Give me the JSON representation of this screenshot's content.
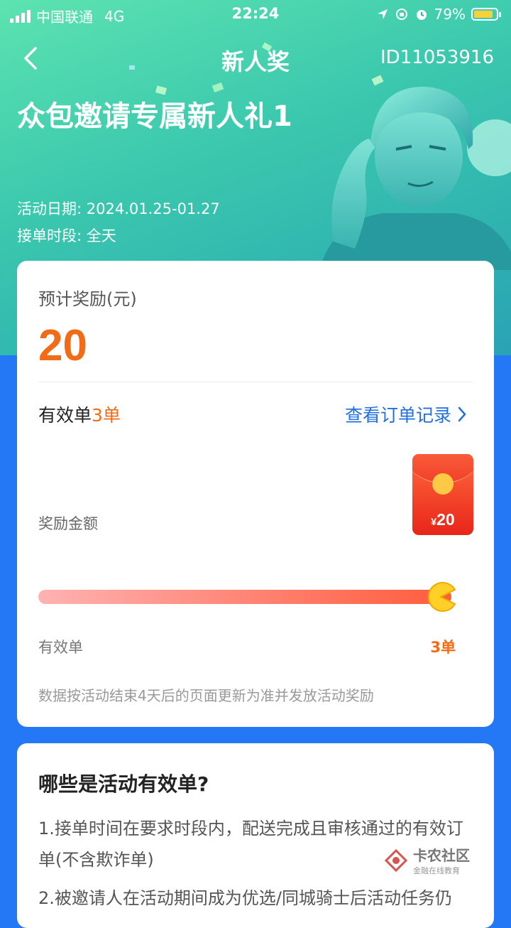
{
  "status_bar": {
    "carrier": "中国联通",
    "network": "4G",
    "time": "22:24",
    "battery_percent": "79%",
    "battery_level": 0.79
  },
  "nav": {
    "title": "新人奖",
    "id_text": "ID11053916"
  },
  "hero": {
    "title": "众包邀请专属新人礼1",
    "date_label": "活动日期:",
    "date_value": "2024.01.25-01.27",
    "period_label": "接单时段:",
    "period_value": "全天"
  },
  "reward_card": {
    "estimate_label": "预计奖励(元)",
    "estimate_value": "20",
    "valid_label": "有效单",
    "valid_count": "3单",
    "record_link": "查看订单记录",
    "reward_amount_label": "奖励金额",
    "envelope_currency": "¥",
    "envelope_value": "20",
    "progress_fraction": 1.0,
    "axis_left": "有效单",
    "axis_right": "3单",
    "note": "数据按活动结束4天后的页面更新为准并发放活动奖励"
  },
  "rules_card": {
    "title": "哪些是活动有效单?",
    "rule1": "1.接单时间在要求时段内，配送完成且审核通过的有效订单(不含欺诈单)",
    "rule2": "2.被邀请人在活动期间成为优选/同城骑士后活动任务仍"
  },
  "watermark": {
    "main": "卡农社区",
    "sub": "金融在线教育"
  },
  "colors": {
    "accent_orange": "#f26b16",
    "link_blue": "#2170e0",
    "page_blue": "#2478f6",
    "hero_green": "#3cc9ae"
  }
}
